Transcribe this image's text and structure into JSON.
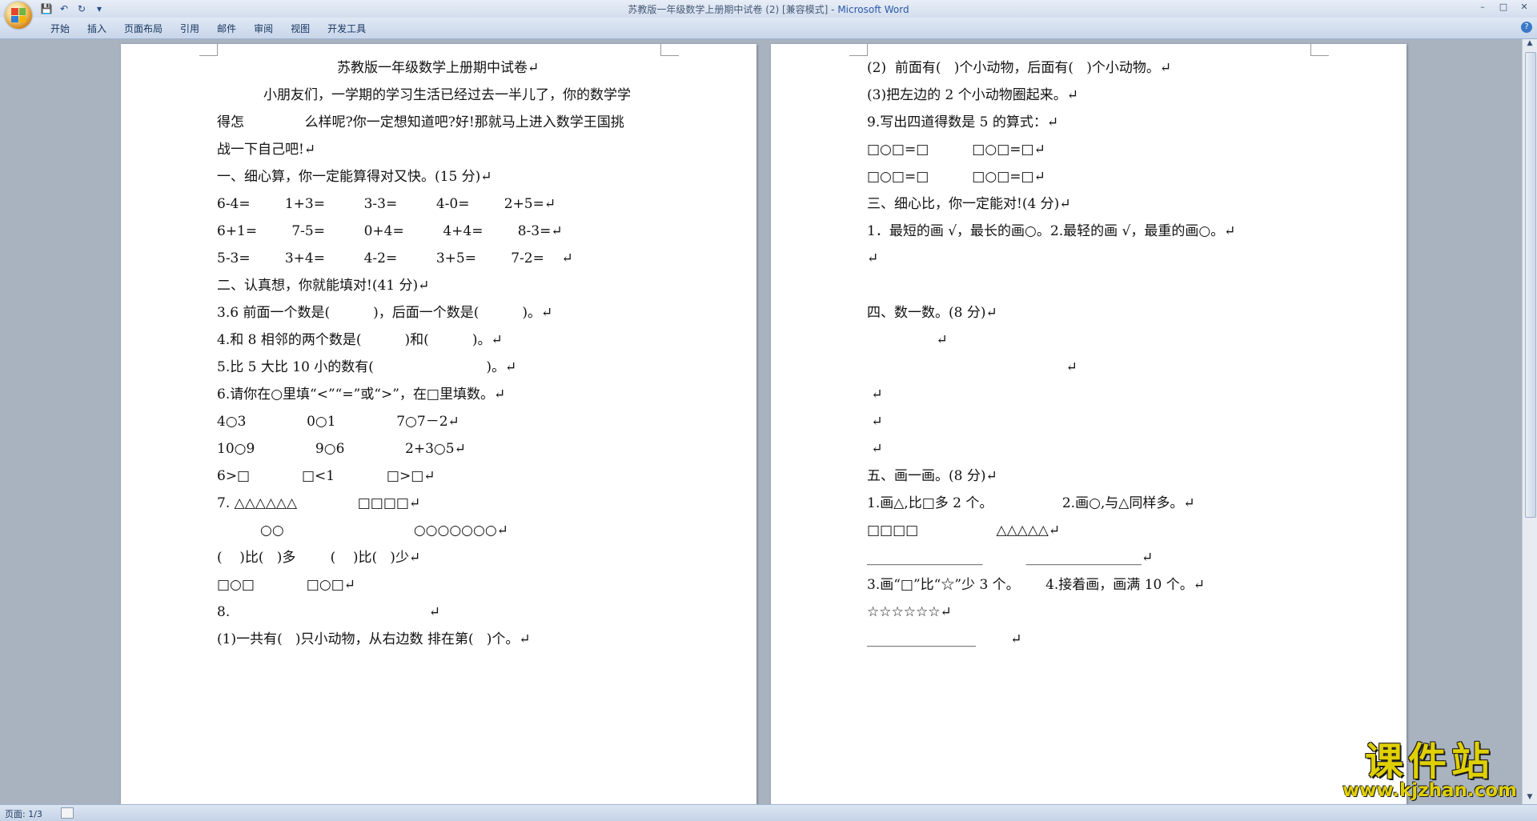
{
  "window": {
    "title": "苏教版一年级数学上册期中试卷 (2) [兼容模式] - ",
    "app_name": "Microsoft Word",
    "controls": [
      "–",
      "□",
      "✕"
    ]
  },
  "qat": {
    "save": "💾",
    "undo": "↶",
    "redo": "↻",
    "more": "▾"
  },
  "ribbon": {
    "tabs": [
      "开始",
      "插入",
      "页面布局",
      "引用",
      "邮件",
      "审阅",
      "视图",
      "开发工具"
    ],
    "help": "?"
  },
  "left_page": [
    "苏教版一年级数学上册期中试卷↵",
    "小朋友们，一学期的学习生活已经过去一半儿了，你的数学学",
    "得怎              么样呢?你一定想知道吧?好!那就马上进入数学王国挑",
    "战一下自己吧!↵",
    "一、细心算，你一定能算得对又快。(15 分)↵",
    "6-4=        1+3=         3-3=         4-0=        2+5=↵",
    "6+1=        7-5=         0+4=         4+4=        8-3=↵",
    "5-3=        3+4=         4-2=         3+5=        7-2=    ↵",
    "二、认真想，你就能填对!(41 分)↵",
    "3.6 前面一个数是(          )，后面一个数是(          )。↵",
    "4.和 8 相邻的两个数是(          )和(          )。↵",
    "5.比 5 大比 10 小的数有(                          )。↵",
    "6.请你在○里填“<”“=”或“>”，在□里填数。↵",
    "4○3              0○1              7○7－2↵",
    "10○9              9○6              2+3○5↵",
    "6>□            □<1            □>□↵",
    "7. △△△△△△              □□□□↵",
    "          ○○                              ○○○○○○○↵",
    "(    )比(   )多        (    )比(   )少↵",
    "□○□            □○□↵",
    "8.                                              ↵",
    "(1)一共有(   )只小动物，从右边数 排在第(   )个。↵"
  ],
  "right_page": [
    "(2)  前面有(   )个小动物，后面有(   )个小动物。↵",
    "(3)把左边的 2 个小动物圈起来。↵",
    "9.写出四道得数是 5 的算式：↵",
    "□○□=□          □○□=□↵",
    "□○□=□          □○□=□↵",
    "三、细心比，你一定能对!(4 分)↵",
    "1．最短的画 √，最长的画○。2.最轻的画 √，最重的画○。↵",
    "↵",
    "",
    "四、数一数。(8 分)↵",
    "                ↵",
    "                                              ↵",
    " ↵",
    " ↵",
    " ↵",
    "五、画一画。(8 分)↵",
    "1.画△,比□多 2 个。                2.画○,与△同样多。↵",
    "□□□□                  △△△△△↵",
    "_________________          _________________↵",
    "3.画“□”比“☆”少 3 个。      4.接着画，画满 10 个。↵",
    "☆☆☆☆☆☆↵",
    "________________        ↵"
  ],
  "status": {
    "page": "页面: 1/3"
  },
  "watermark": {
    "big": "课件站",
    "small": "www.kjzhan.com"
  }
}
